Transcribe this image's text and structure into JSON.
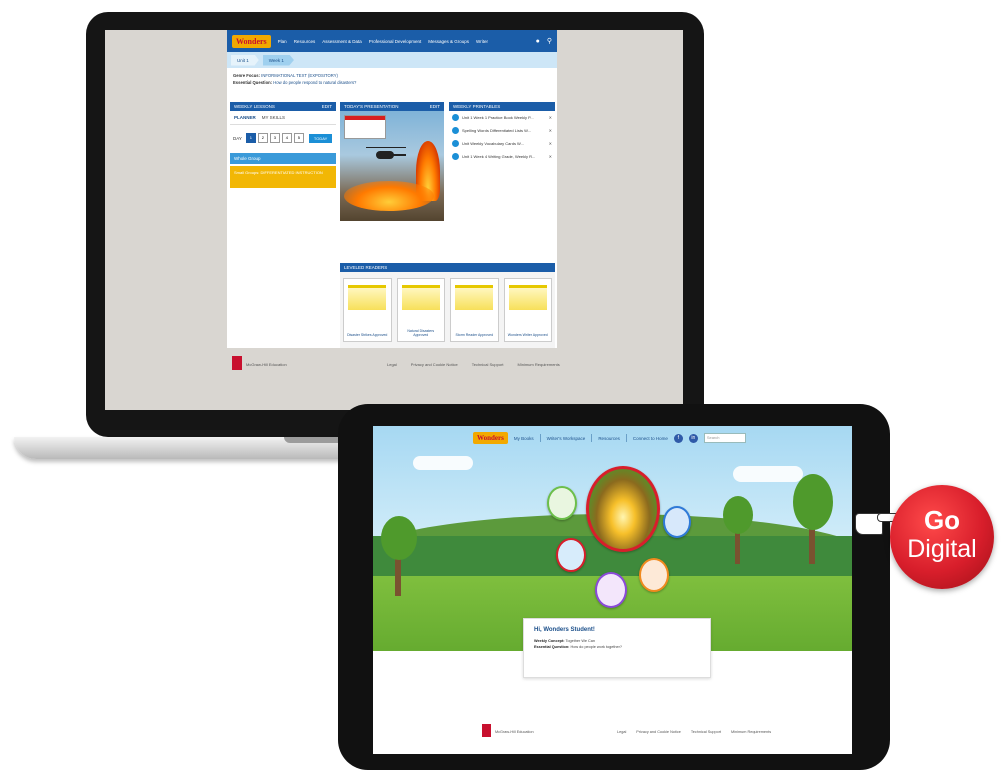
{
  "laptop": {
    "site": {
      "logo": "Wonders",
      "nav": [
        "Plan",
        "Resources",
        "Assessment & Data",
        "Professional Development",
        "Messages & Groups",
        "Writer"
      ],
      "breadcrumbs": [
        "Unit 1",
        "Week 1"
      ],
      "focus": {
        "genre_label": "Genre Focus:",
        "genre_value": "INFORMATIONAL TEXT (EXPOSITORY)",
        "question_label": "Essential Question:",
        "question_value": "How do people respond to natural disasters?"
      },
      "weekly_lessons": {
        "title": "WEEKLY LESSONS",
        "action": "EDIT",
        "tabs": [
          "PLANNER",
          "MY SKILLS"
        ],
        "day_label": "DAY",
        "days": [
          "1",
          "2",
          "3",
          "4",
          "5"
        ],
        "today_button": "TODAY",
        "whole_group": "Whole Group",
        "small_group": "Small Groups: DIFFERENTIATED INSTRUCTION"
      },
      "presentation": {
        "title": "TODAY'S PRESENTATION",
        "action": "EDIT"
      },
      "printables": {
        "title": "WEEKLY PRINTABLES",
        "items": [
          "Unit 1 Week 1 Practice Book Weekly P...",
          "Spelling Words Differentiated Lists W...",
          "Unit Weekly Vocabulary Cards W...",
          "Unit 1 Week 4 Writing Grade, Weekly R..."
        ]
      },
      "leveled_readers": {
        "title": "LEVELED READERS",
        "items": [
          "Disaster Strikes Approved",
          "Natural Disasters Approved",
          "Storm Reader Approved",
          "Wonders Writer Approved"
        ]
      },
      "footer": {
        "brand": "McGraw-Hill Education",
        "links": [
          "Legal",
          "Privacy and Cookie Notice",
          "Technical Support",
          "Minimum Requirements"
        ]
      }
    }
  },
  "tablet": {
    "logo": "Wonders",
    "nav": [
      "My Books",
      "Writer's Workspace",
      "Resources",
      "Connect to Home"
    ],
    "social": [
      "f",
      "in"
    ],
    "search_placeholder": "Search",
    "card": {
      "title": "Hi, Wonders Student!",
      "concept_label": "Weekly Concept:",
      "concept_value": "Together We Can",
      "question_label": "Essential Question:",
      "question_value": "How do people work together?"
    },
    "footer": {
      "brand": "McGraw-Hill Education",
      "links": [
        "Legal",
        "Privacy and Cookie Notice",
        "Technical Support",
        "Minimum Requirements"
      ]
    }
  },
  "badge": {
    "line1": "Go",
    "line2": "Digital"
  },
  "colors": {
    "brand_blue": "#1b5da8",
    "accent_red": "#d81e2b",
    "wonders_yellow": "#f2a900"
  }
}
